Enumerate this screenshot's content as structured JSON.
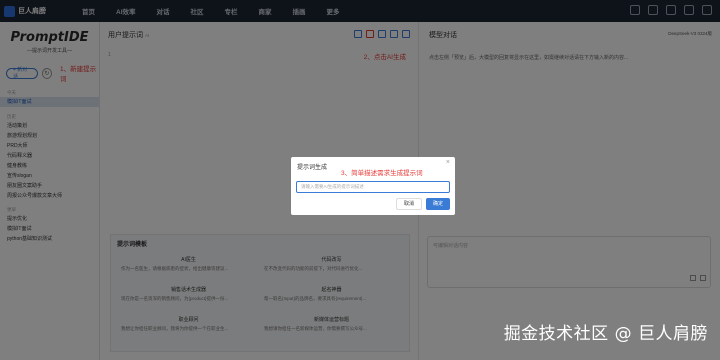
{
  "topbar": {
    "brand": "巨人肩膀",
    "nav": [
      "首页",
      "AI效率",
      "对话",
      "社区",
      "专栏",
      "商家",
      "插画",
      "更多"
    ]
  },
  "sidebar": {
    "title": "PromptIDE",
    "slogan": "—提示词开发工具—",
    "new_button": "+ 新对话",
    "annotation": "1、新建提示词",
    "section_today": "今天",
    "items_top": [
      "模拟IT面试"
    ],
    "section_history": "历史",
    "items": [
      "活动策划",
      "旅游规划规划",
      "PRD大师",
      "代码释义器",
      "健身教练",
      "宣传slogan",
      "朋友圈文案助手",
      "周报公众号爆款文章大师"
    ],
    "section_old": "更早",
    "items_bottom": [
      "提示优化",
      "模拟IT面试",
      "python基础知识测试"
    ]
  },
  "editor": {
    "title": "用户提示词",
    "title_badge": "AI",
    "line_no": "1",
    "annotation": "2、点击AI生成"
  },
  "templates": {
    "title": "提示词模板",
    "cards": [
      {
        "name": "AI医生",
        "desc": "作为一名医生，请根据病患的症状，给出健康等建议..."
      },
      {
        "name": "代码改写",
        "desc": "在不改变代码的功能的前提下，对代码进行优化..."
      },
      {
        "name": "销售话术生成器",
        "desc": "现在你是一名资深的销售顾问，为{product}提供一份..."
      },
      {
        "name": "起名神器",
        "desc": "帮一取名{Input}的品牌名，要求具有{requirement}..."
      },
      {
        "name": "职业顾问",
        "desc": "我想让你担任职业顾问，我将为你提供一个在职业生..."
      },
      {
        "name": "新媒体运营标题",
        "desc": "我想请你担任一名新媒体运营，你需要撰写公众号..."
      }
    ]
  },
  "right": {
    "title": "模型对话",
    "model": "DeepSeek-V3 0324版",
    "tip": "点击左侧「预览」后，大模型的回复将显示在这里，如需继续对话请在下方输入新的内容...",
    "input_placeholder": "可编辑对话内容"
  },
  "modal": {
    "title": "提示词生成",
    "annotation": "3、简单描述需求生成提示词",
    "placeholder": "请输入需要AI生成的提示词描述",
    "cancel": "取消",
    "ok": "确定"
  },
  "watermark": "掘金技术社区 @ 巨人肩膀"
}
